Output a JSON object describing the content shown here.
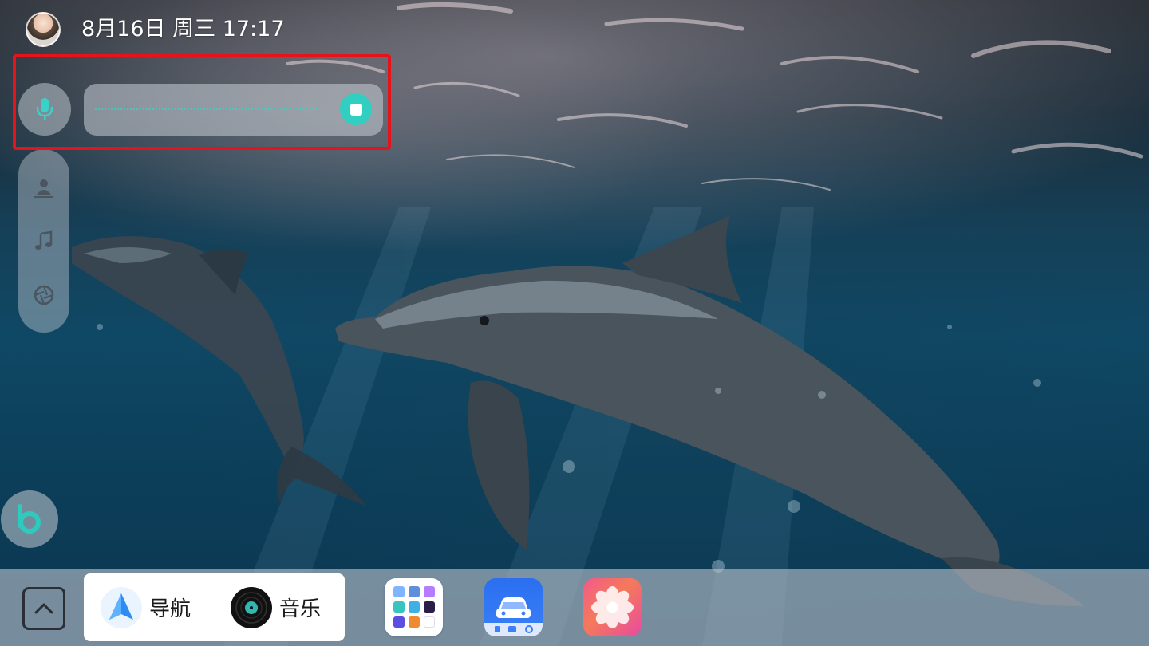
{
  "status_bar": {
    "datetime": "8月16日 周三 17:17",
    "avatar_icon": "user-avatar"
  },
  "voice_assistant": {
    "state": "listening",
    "mic_icon": "microphone-icon",
    "stop_icon": "stop-icon",
    "accent_color": "#30cfc2",
    "highlight_color": "#e8121a"
  },
  "side_rail": {
    "items": [
      {
        "icon": "location-person-icon"
      },
      {
        "icon": "music-note-icon"
      },
      {
        "icon": "camera-shutter-icon"
      }
    ]
  },
  "assistant_button": {
    "icon": "assistant-b-icon"
  },
  "dock": {
    "expand_icon": "chevron-up-icon",
    "shortcuts": [
      {
        "label": "导航",
        "icon": "navigation-icon"
      },
      {
        "label": "音乐",
        "icon": "music-disc-icon"
      }
    ],
    "apps": [
      {
        "icon": "app-grid-icon"
      },
      {
        "icon": "car-control-icon"
      },
      {
        "icon": "gallery-flower-icon"
      }
    ]
  }
}
